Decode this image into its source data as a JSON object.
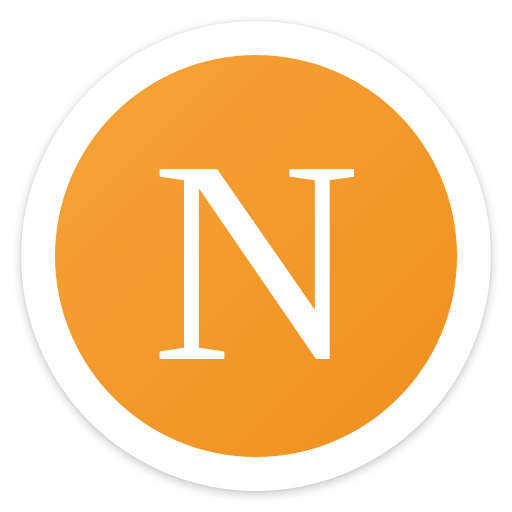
{
  "app_icon": {
    "monogram": "N",
    "colors": {
      "disc_top": "#f5a43a",
      "disc_bottom": "#f08f1e",
      "ring": "#ffffff",
      "monogram": "#ffffff"
    }
  }
}
